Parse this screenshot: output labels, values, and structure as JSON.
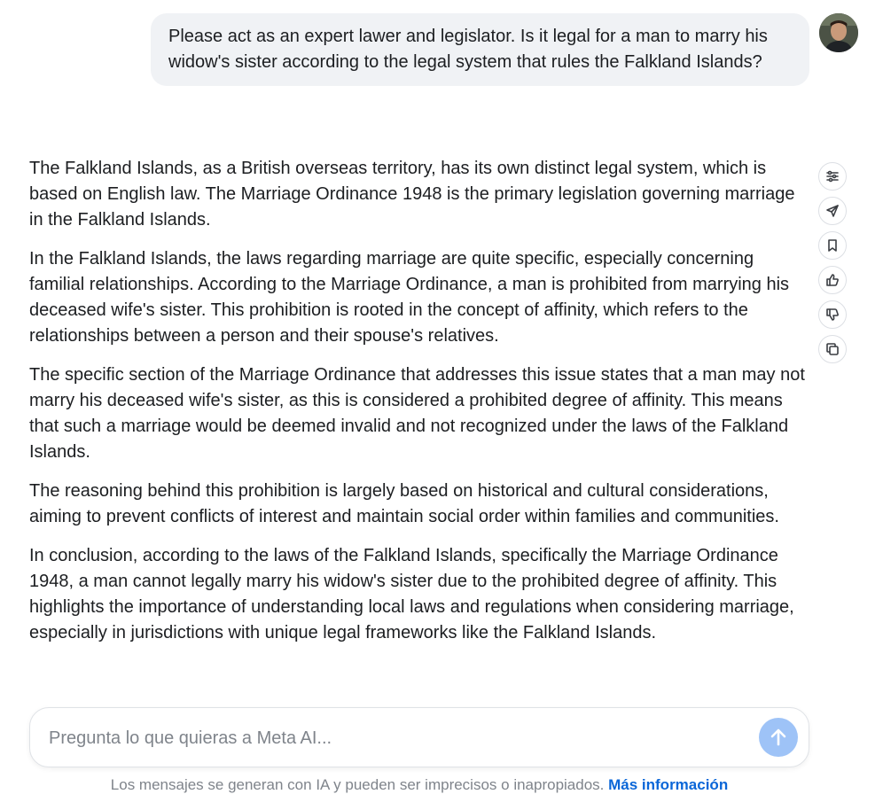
{
  "user_message": {
    "text": "Please act as an expert lawer and legislator. Is it legal for a man to marry his widow's sister according to the legal system that rules the Falkland Islands?"
  },
  "response": {
    "paragraphs": [
      "The Falkland Islands, as a British overseas territory, has its own distinct legal system, which is based on English law. The Marriage Ordinance 1948 is the primary legislation governing marriage in the Falkland Islands.",
      "In the Falkland Islands, the laws regarding marriage are quite specific, especially concerning familial relationships. According to the Marriage Ordinance, a man is prohibited from marrying his deceased wife's sister. This prohibition is rooted in the concept of affinity, which refers to the relationships between a person and their spouse's relatives.",
      "The specific section of the Marriage Ordinance that addresses this issue states that a man may not marry his deceased wife's sister, as this is considered a prohibited degree of affinity. This means that such a marriage would be deemed invalid and not recognized under the laws of the Falkland Islands.",
      "The reasoning behind this prohibition is largely based on historical and cultural considerations, aiming to prevent conflicts of interest and maintain social order within families and communities.",
      "In conclusion, according to the laws of the Falkland Islands, specifically the Marriage Ordinance 1948, a man cannot legally marry his widow's sister due to the prohibited degree of affinity. This highlights the importance of understanding local laws and regulations when considering marriage, especially in jurisdictions with unique legal frameworks like the Falkland Islands."
    ]
  },
  "actions": [
    {
      "icon": "sliders-icon"
    },
    {
      "icon": "share-send-icon"
    },
    {
      "icon": "bookmark-icon"
    },
    {
      "icon": "thumbs-up-icon"
    },
    {
      "icon": "thumbs-down-icon"
    },
    {
      "icon": "copy-icon"
    }
  ],
  "composer": {
    "placeholder": "Pregunta lo que quieras a Meta AI...",
    "value": "",
    "send_icon": "arrow-up-icon"
  },
  "footer": {
    "disclaimer": "Los mensajes se generan con IA y pueden ser imprecisos o inapropiados.",
    "link_label": "Más información"
  },
  "colors": {
    "bubble_bg": "#f0f2f5",
    "send_button": "#9ec3f7",
    "link": "#0a66d8",
    "muted_text": "#7f848b"
  }
}
